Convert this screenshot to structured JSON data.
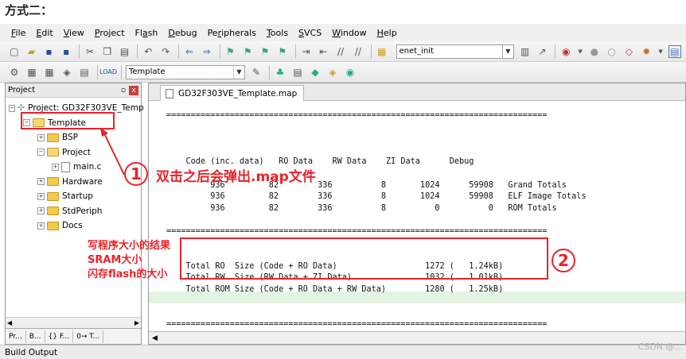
{
  "heading": "方式二：",
  "menu": [
    "File",
    "Edit",
    "View",
    "Project",
    "Flash",
    "Debug",
    "Peripherals",
    "Tools",
    "SVCS",
    "Window",
    "Help"
  ],
  "menu_underline": [
    "F",
    "E",
    "V",
    "P",
    "a",
    "D",
    "r",
    "T",
    "S",
    "W",
    "H"
  ],
  "toolbar1": {
    "target_combo": "enet_init"
  },
  "toolbar2": {
    "target_select": "Template"
  },
  "project_panel": {
    "title": "Project",
    "pin_icon": "pin-icon",
    "close_label": "x",
    "tree": [
      {
        "label": "Project: GD32F303VE_Temp",
        "level": 0,
        "type": "project",
        "expander": "−"
      },
      {
        "label": "Template",
        "level": 1,
        "type": "folder-open",
        "expander": "−"
      },
      {
        "label": "BSP",
        "level": 2,
        "type": "folder",
        "expander": "+"
      },
      {
        "label": "Project",
        "level": 2,
        "type": "folder-open",
        "expander": "−"
      },
      {
        "label": "main.c",
        "level": 3,
        "type": "file",
        "expander": "+"
      },
      {
        "label": "Hardware",
        "level": 2,
        "type": "folder",
        "expander": "+"
      },
      {
        "label": "Startup",
        "level": 2,
        "type": "folder",
        "expander": "+"
      },
      {
        "label": "StdPeriph",
        "level": 2,
        "type": "folder",
        "expander": "+"
      },
      {
        "label": "Docs",
        "level": 2,
        "type": "folder",
        "expander": "+"
      }
    ],
    "tabs": [
      "Pr...",
      "B...",
      "{} F...",
      "0→ T..."
    ]
  },
  "editor": {
    "tab_label": "GD32F303VE_Template.map",
    "code_lines": [
      "==============================================================================",
      "",
      "",
      "",
      "    Code (inc. data)   RO Data    RW Data    ZI Data      Debug",
      "",
      "         936         82        336          8       1024      59908   Grand Totals",
      "         936         82        336          8       1024      59908   ELF Image Totals",
      "         936         82        336          8          0          0   ROM Totals",
      "",
      "==============================================================================",
      "",
      "",
      "    Total RO  Size (Code + RO Data)                  1272 (   1.24kB)",
      "    Total RW  Size (RW Data + ZI Data)               1032 (   1.01kB)",
      "    Total ROM Size (Code + RO Data + RW Data)        1280 (   1.25kB)",
      "",
      "",
      "=============================================================================="
    ]
  },
  "bottom_label": "Build Output",
  "watermark": "CSDN @...",
  "annotations": {
    "circle1": "1",
    "circle2": "2",
    "double_click_note": "双击之后会弹出.map文件",
    "side_notes": [
      "写程序大小的结果",
      "SRAM大小",
      "闪存flash的大小"
    ]
  },
  "colors": {
    "annotation_red": "#e8232b",
    "highlight_green": "#e4f4e4"
  }
}
